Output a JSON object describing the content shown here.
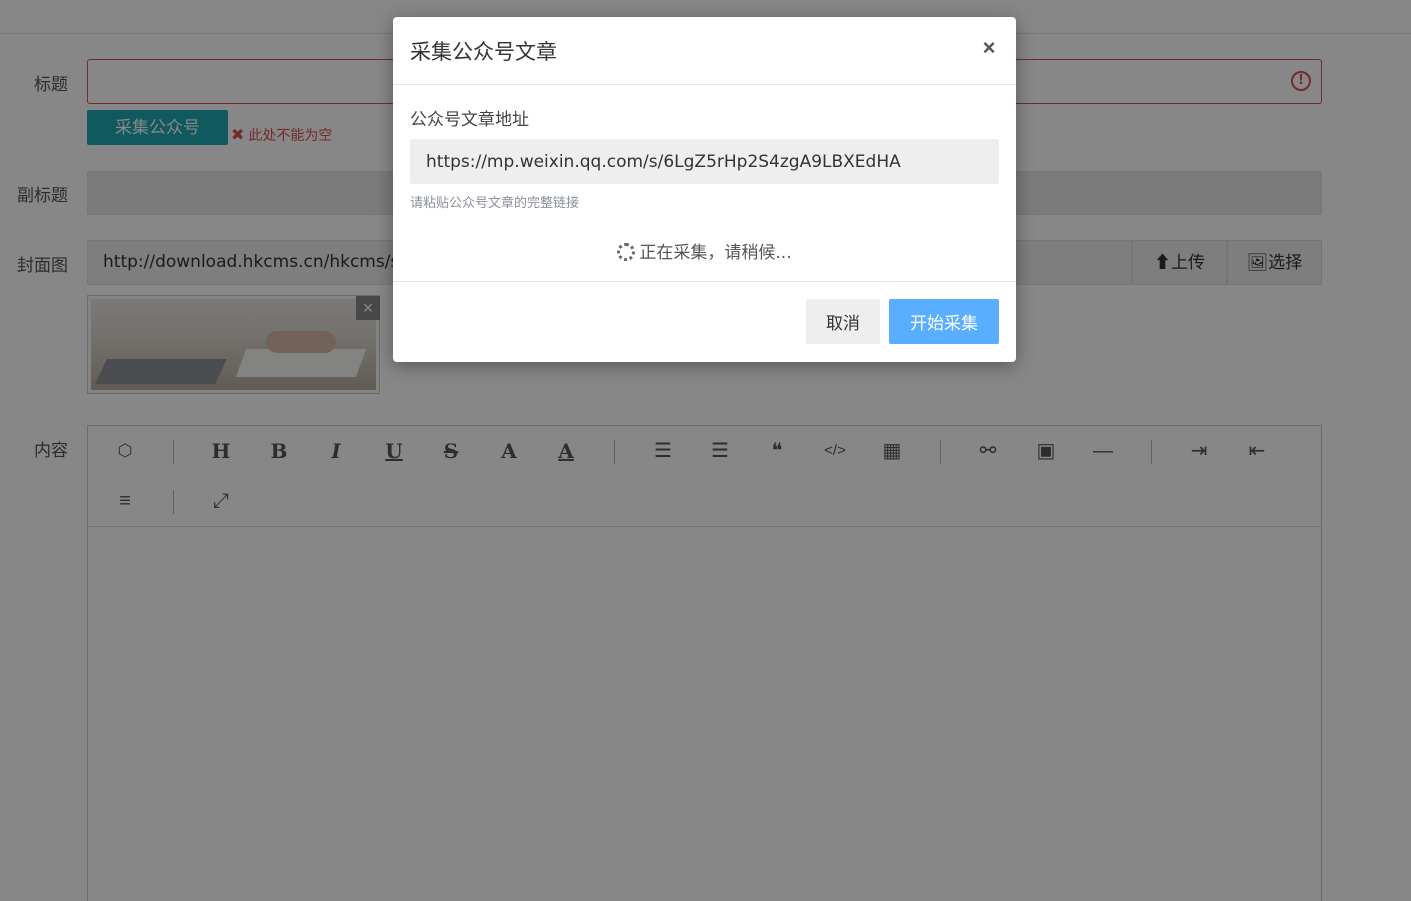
{
  "form": {
    "title_label": "标题",
    "title_error_icon": "!",
    "collect_button": "采集公众号",
    "error_icon": "✖",
    "error_message": "此处不能为空",
    "subtitle_label": "副标题",
    "cover_label": "封面图",
    "cover_value": "http://download.hkcms.cn/hkcms/s",
    "upload_button": "⬆上传",
    "select_button": "🖼选择",
    "thumb_close": "×",
    "content_label": "内容"
  },
  "toolbar": {
    "html5": "⬡",
    "heading": "H",
    "bold": "B",
    "italic": "I",
    "underline": "U",
    "strike": "S",
    "font": "A",
    "color": "A",
    "ordered_list": "☰",
    "unordered_list": "☰",
    "quote": "❝",
    "code": "</>",
    "table": "▦",
    "link": "⚯",
    "image": "▣",
    "hr": "—",
    "indent": "⇥",
    "outdent": "⇤",
    "align": "≡",
    "fullscreen": "⤢"
  },
  "modal": {
    "title": "采集公众号文章",
    "close": "×",
    "field_label": "公众号文章地址",
    "url_value": "https://mp.weixin.qq.com/s/6LgZ5rHp2S4zgA9LBXEdHA",
    "help_text": "请粘贴公众号文章的完整链接",
    "loading_text": "正在采集，请稍候...",
    "cancel_button": "取消",
    "start_button": "开始采集"
  },
  "colors": {
    "primary_button": "#5aaeff",
    "collect_button": "#1ea9b4",
    "error": "#d9534f"
  }
}
